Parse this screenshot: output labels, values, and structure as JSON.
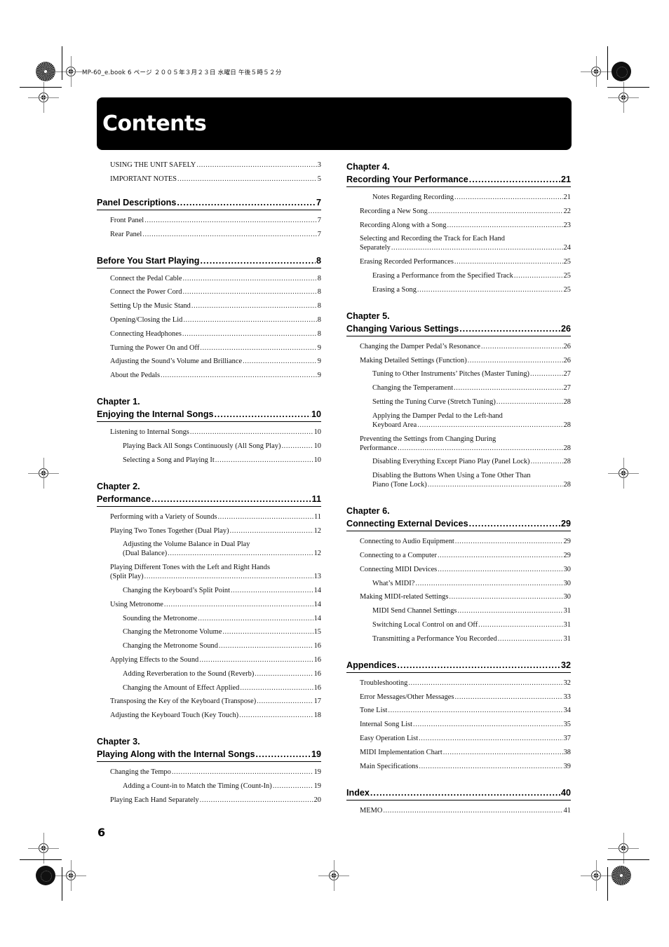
{
  "print_header": "MP-60_e.book  6 ページ  ２００５年３月２３日  水曜日  午後５時５２分",
  "title": "Contents",
  "page_number": "6",
  "left_column": {
    "intro": [
      {
        "text": "USING THE UNIT SAFELY",
        "page": "3",
        "level": 1
      },
      {
        "text": "IMPORTANT NOTES",
        "page": "5",
        "level": 1
      }
    ],
    "sections": [
      {
        "chapter": "",
        "heading": "Panel Descriptions",
        "page": "7",
        "items": [
          {
            "text": "Front Panel",
            "page": "7",
            "level": 1
          },
          {
            "text": "Rear Panel",
            "page": "7",
            "level": 1
          }
        ]
      },
      {
        "chapter": "",
        "heading": "Before You Start Playing",
        "page": "8",
        "items": [
          {
            "text": "Connect the Pedal Cable",
            "page": "8",
            "level": 1
          },
          {
            "text": "Connect the Power Cord",
            "page": "8",
            "level": 1
          },
          {
            "text": "Setting Up the Music Stand",
            "page": "8",
            "level": 1
          },
          {
            "text": "Opening/Closing the Lid",
            "page": "8",
            "level": 1
          },
          {
            "text": "Connecting Headphones",
            "page": "8",
            "level": 1
          },
          {
            "text": "Turning the Power On and Off",
            "page": "9",
            "level": 1
          },
          {
            "text": "Adjusting the Sound’s Volume and Brilliance",
            "page": "9",
            "level": 1
          },
          {
            "text": "About the Pedals",
            "page": "9",
            "level": 1
          }
        ]
      },
      {
        "chapter": "Chapter 1.",
        "heading": "Enjoying the Internal Songs",
        "page": "10",
        "items": [
          {
            "text": "Listening to Internal Songs",
            "page": "10",
            "level": 1
          },
          {
            "text": "Playing Back All Songs Continuously (All Song Play)",
            "page": "10",
            "level": 2
          },
          {
            "text": "Selecting a Song and Playing It",
            "page": "10",
            "level": 2
          }
        ]
      },
      {
        "chapter": "Chapter 2.",
        "heading": "Performance",
        "page": "11",
        "items": [
          {
            "text": "Performing with a Variety of Sounds",
            "page": "11",
            "level": 1
          },
          {
            "text": "Playing Two Tones Together (Dual Play)",
            "page": "12",
            "level": 1
          },
          {
            "first_line": "Adjusting the Volume Balance in Dual Play",
            "text": "(Dual Balance)",
            "page": "12",
            "level": 2
          },
          {
            "first_line": "Playing Different Tones with the Left and Right Hands",
            "text": "(Split Play)",
            "page": "13",
            "level": 1
          },
          {
            "text": "Changing the Keyboard’s Split Point",
            "page": "14",
            "level": 2
          },
          {
            "text": "Using Metronome",
            "page": "14",
            "level": 1
          },
          {
            "text": "Sounding the Metronome",
            "page": "14",
            "level": 2
          },
          {
            "text": "Changing the Metronome Volume",
            "page": "15",
            "level": 2
          },
          {
            "text": "Changing the Metronome Sound",
            "page": "16",
            "level": 2
          },
          {
            "text": "Applying Effects to the Sound",
            "page": "16",
            "level": 1
          },
          {
            "text": "Adding Reverberation to the Sound (Reverb)",
            "page": "16",
            "level": 2
          },
          {
            "text": "Changing the Amount of Effect Applied",
            "page": "16",
            "level": 2
          },
          {
            "text": "Transposing the Key of the Keyboard (Transpose)",
            "page": "17",
            "level": 1
          },
          {
            "text": "Adjusting the Keyboard Touch (Key Touch)",
            "page": "18",
            "level": 1
          }
        ]
      },
      {
        "chapter": "Chapter 3.",
        "heading": "Playing Along with the Internal Songs",
        "page": "19",
        "items": [
          {
            "text": "Changing the Tempo",
            "page": "19",
            "level": 1
          },
          {
            "text": "Adding a Count-in to Match the Timing (Count-In)",
            "page": "19",
            "level": 2
          },
          {
            "text": "Playing Each Hand Separately",
            "page": "20",
            "level": 1
          }
        ]
      }
    ]
  },
  "right_column": {
    "sections": [
      {
        "chapter": "Chapter 4.",
        "heading": "Recording Your Performance",
        "page": "21",
        "items": [
          {
            "text": "Notes Regarding Recording",
            "page": "21",
            "level": 2
          },
          {
            "text": "Recording a New Song",
            "page": "22",
            "level": 1
          },
          {
            "text": "Recording Along with a Song",
            "page": "23",
            "level": 1
          },
          {
            "first_line": "Selecting and Recording the Track for Each Hand",
            "text": "Separately",
            "page": "24",
            "level": 1
          },
          {
            "text": "Erasing Recorded Performances",
            "page": "25",
            "level": 1
          },
          {
            "text": "Erasing a Performance from the Specified Track",
            "page": "25",
            "level": 2
          },
          {
            "text": "Erasing a Song",
            "page": "25",
            "level": 2
          }
        ]
      },
      {
        "chapter": "Chapter 5.",
        "heading": "Changing Various Settings",
        "page": "26",
        "items": [
          {
            "text": "Changing the Damper Pedal’s Resonance",
            "page": "26",
            "level": 1
          },
          {
            "text": "Making Detailed Settings (Function)",
            "page": "26",
            "level": 1
          },
          {
            "text": "Tuning to Other Instruments’ Pitches (Master Tuning)",
            "page": "27",
            "level": 2
          },
          {
            "text": "Changing the Temperament",
            "page": "27",
            "level": 2
          },
          {
            "text": "Setting the Tuning Curve (Stretch Tuning)",
            "page": "28",
            "level": 2
          },
          {
            "first_line": "Applying the Damper Pedal to the Left-hand",
            "text": "Keyboard Area",
            "page": "28",
            "level": 2
          },
          {
            "first_line": "Preventing the Settings from Changing During",
            "text": "Performance",
            "page": "28",
            "level": 1
          },
          {
            "text": "Disabling Everything Except Piano Play (Panel Lock)",
            "page": "28",
            "level": 2
          },
          {
            "first_line": "Disabling the Buttons When Using a Tone Other Than",
            "text": "Piano (Tone Lock)",
            "page": "28",
            "level": 2
          }
        ]
      },
      {
        "chapter": "Chapter 6.",
        "heading": "Connecting External Devices",
        "page": "29",
        "items": [
          {
            "text": "Connecting to Audio Equipment",
            "page": "29",
            "level": 1
          },
          {
            "text": "Connecting to a Computer",
            "page": "29",
            "level": 1
          },
          {
            "text": "Connecting MIDI Devices",
            "page": "30",
            "level": 1
          },
          {
            "text": "What’s MIDI?",
            "page": "30",
            "level": 2
          },
          {
            "text": "Making MIDI-related Settings",
            "page": "30",
            "level": 1
          },
          {
            "text": "MIDI Send Channel Settings",
            "page": "31",
            "level": 2
          },
          {
            "text": "Switching Local Control on and Off",
            "page": "31",
            "level": 2
          },
          {
            "text": "Transmitting a Performance You Recorded",
            "page": "31",
            "level": 2
          }
        ]
      },
      {
        "chapter": "",
        "heading": "Appendices",
        "page": "32",
        "items": [
          {
            "text": "Troubleshooting",
            "page": "32",
            "level": 1
          },
          {
            "text": "Error Messages/Other Messages",
            "page": "33",
            "level": 1
          },
          {
            "text": "Tone List",
            "page": "34",
            "level": 1
          },
          {
            "text": "Internal Song List",
            "page": "35",
            "level": 1
          },
          {
            "text": "Easy Operation List",
            "page": "37",
            "level": 1
          },
          {
            "text": "MIDI Implementation Chart",
            "page": "38",
            "level": 1
          },
          {
            "text": "Main Specifications",
            "page": "39",
            "level": 1
          }
        ]
      },
      {
        "chapter": "",
        "heading": "Index",
        "page": "40",
        "items": [
          {
            "text": "MEMO",
            "page": "41",
            "level": 1
          }
        ]
      }
    ]
  }
}
